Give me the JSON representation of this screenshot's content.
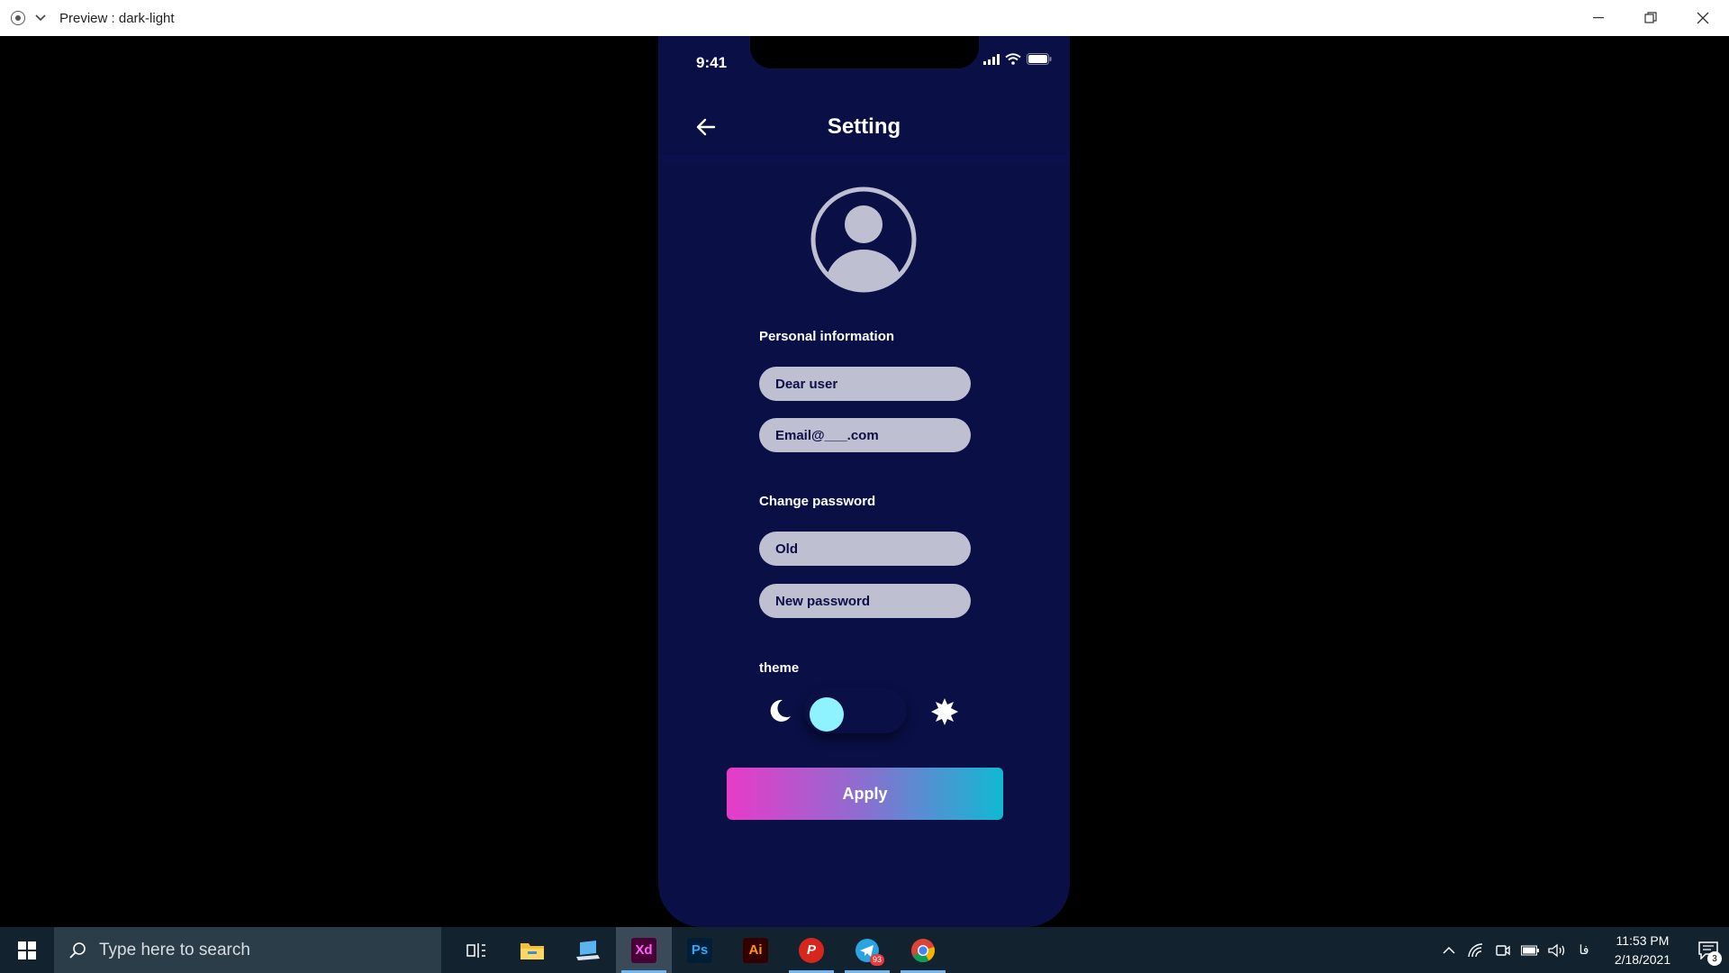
{
  "window": {
    "title": "Preview : dark-light"
  },
  "phone": {
    "status": {
      "time": "9:41"
    },
    "header": {
      "title": "Setting"
    },
    "personal": {
      "label": "Personal information",
      "name_value": "Dear user",
      "email_value": "Email@___.com"
    },
    "password": {
      "label": "Change password",
      "old_placeholder": "Old",
      "new_placeholder": "New password"
    },
    "theme": {
      "label": "theme",
      "selected": "dark"
    },
    "apply_label": "Apply",
    "colors": {
      "background": "#0a0f46",
      "field": "#bfbfd2",
      "knob": "#8ef2ff",
      "gradient_start": "#e83bc8",
      "gradient_end": "#10b9d2"
    }
  },
  "taskbar": {
    "search_placeholder": "Type here to search",
    "apps": [
      {
        "name": "task-view-icon"
      },
      {
        "name": "file-explorer-icon"
      },
      {
        "name": "laptop-app-icon"
      },
      {
        "name": "adobe-xd-icon",
        "label": "Xd",
        "active": true
      },
      {
        "name": "photoshop-icon",
        "label": "Ps"
      },
      {
        "name": "illustrator-icon",
        "label": "Ai"
      },
      {
        "name": "psiphon-icon",
        "label": "P"
      },
      {
        "name": "telegram-icon",
        "badge": "93"
      },
      {
        "name": "chrome-icon"
      }
    ],
    "tray_lang": "فا",
    "time": "11:53 PM",
    "date": "2/18/2021",
    "notification_count": "3"
  }
}
